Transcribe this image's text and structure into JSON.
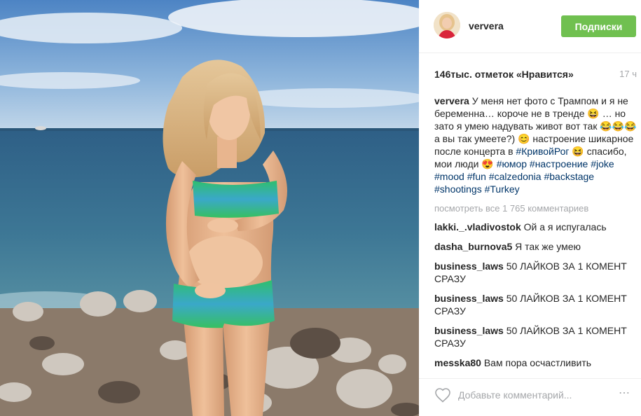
{
  "post": {
    "username": "ververa",
    "follow_label": "Подписки",
    "likes": "146тыс. отметок «Нравится»",
    "time": "17 ч",
    "caption": {
      "user": "ververa",
      "text1": "У меня нет фото с Трампом и я не беременна… короче не в тренде 😆 … но зато я умею надувать живот вот так 😂😂😂 а вы так умеете?) 😊 настроение шикарное после концерта в ",
      "tag0": "#КривойРог",
      "text2": " 😆 спасибо, мои люди 😍 ",
      "tags": [
        "#юмор",
        "#настроение",
        "#joke",
        "#mood",
        "#fun",
        "#calzedonia",
        "#backstage",
        "#shootings",
        "#Turkey"
      ]
    },
    "view_all": "посмотреть все 1 765 комментариев",
    "comments": [
      {
        "user": "lakki._.vladivostok",
        "text": "Ой а я испугалась"
      },
      {
        "user": "dasha_burnova5",
        "text": "Я так же умею"
      },
      {
        "user": "business_laws",
        "text": "50 ЛАЙКОВ ЗА 1 КОМЕНТ СРАЗУ"
      },
      {
        "user": "business_laws",
        "text": "50 ЛАЙКОВ ЗА 1 КОМЕНТ СРАЗУ"
      },
      {
        "user": "business_laws",
        "text": "50 ЛАЙКОВ ЗА 1 КОМЕНТ СРАЗУ"
      },
      {
        "user": "messka80",
        "text": "Вам пора осчастливить"
      }
    ],
    "comment_placeholder": "Добавьте комментарий...",
    "more_icon": "⋯"
  },
  "colors": {
    "follow_button": "#70c050",
    "hashtag": "#003569",
    "muted": "#a5a7aa"
  },
  "icons": {
    "like": "heart-icon",
    "more": "ellipsis-icon"
  }
}
